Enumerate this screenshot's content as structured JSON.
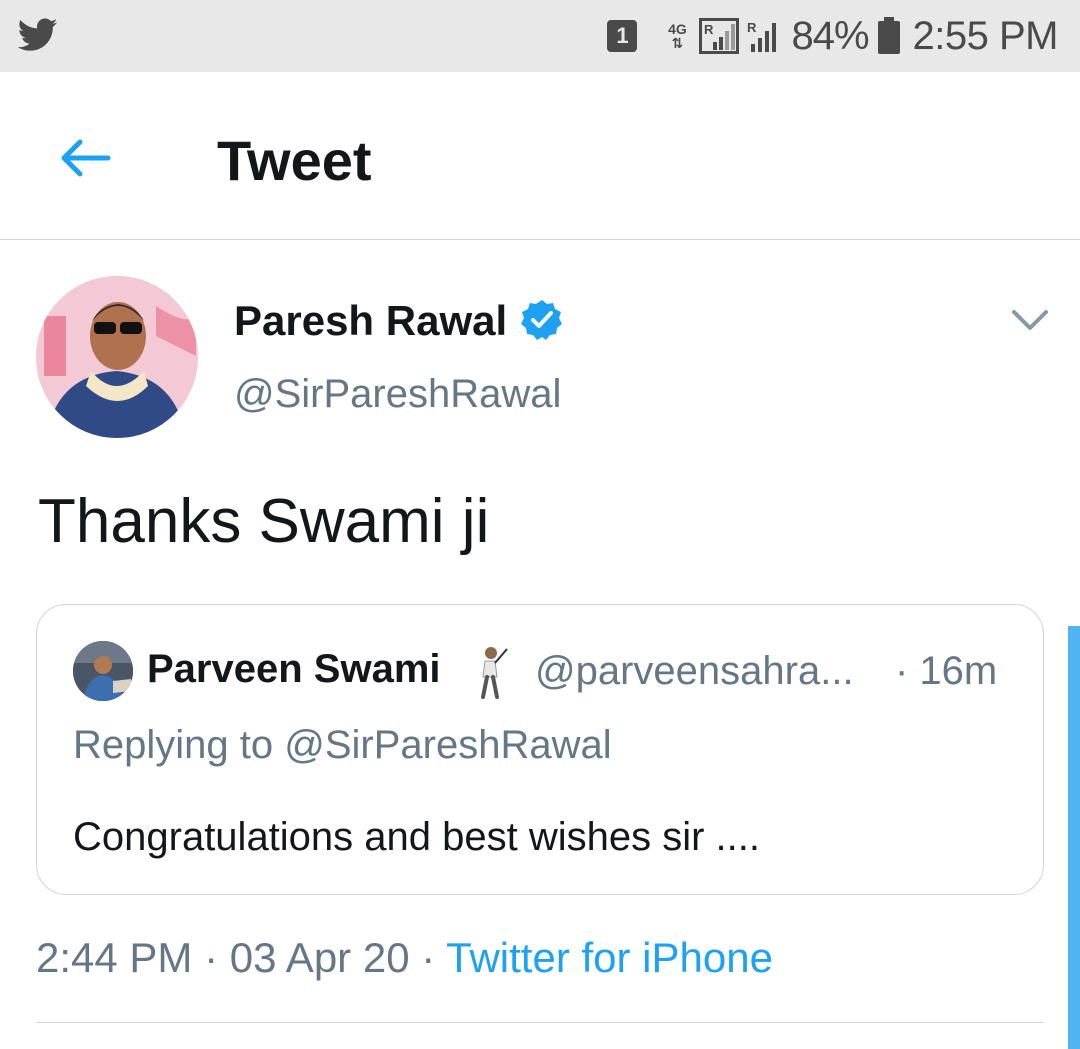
{
  "status_bar": {
    "notification_count": "1",
    "network": "4G",
    "battery_percent": "84%",
    "time": "2:55 PM",
    "icons": [
      "twitter-icon",
      "signal-icon",
      "battery-icon"
    ]
  },
  "header": {
    "title": "Tweet",
    "back_icon": "arrow-left-icon"
  },
  "tweet": {
    "author_name": "Paresh Rawal",
    "author_handle": "@SirPareshRawal",
    "text": "Thanks Swami ji",
    "timestamp": "2:44 PM · 03 Apr 20 · ",
    "source": "Twitter for iPhone"
  },
  "quoted_tweet": {
    "author_name": "Parveen Swami",
    "author_handle": "@parveensahra...",
    "time": "· 16m",
    "replying_to": "Replying to @SirPareshRawal",
    "text": "Congratulations and best wishes sir ...."
  },
  "colors": {
    "accent": "#1da1f2",
    "secondary_text": "#657786",
    "primary_text": "#14171a",
    "status_bar_bg": "#e8e8e8",
    "border": "#ccd6dd"
  }
}
